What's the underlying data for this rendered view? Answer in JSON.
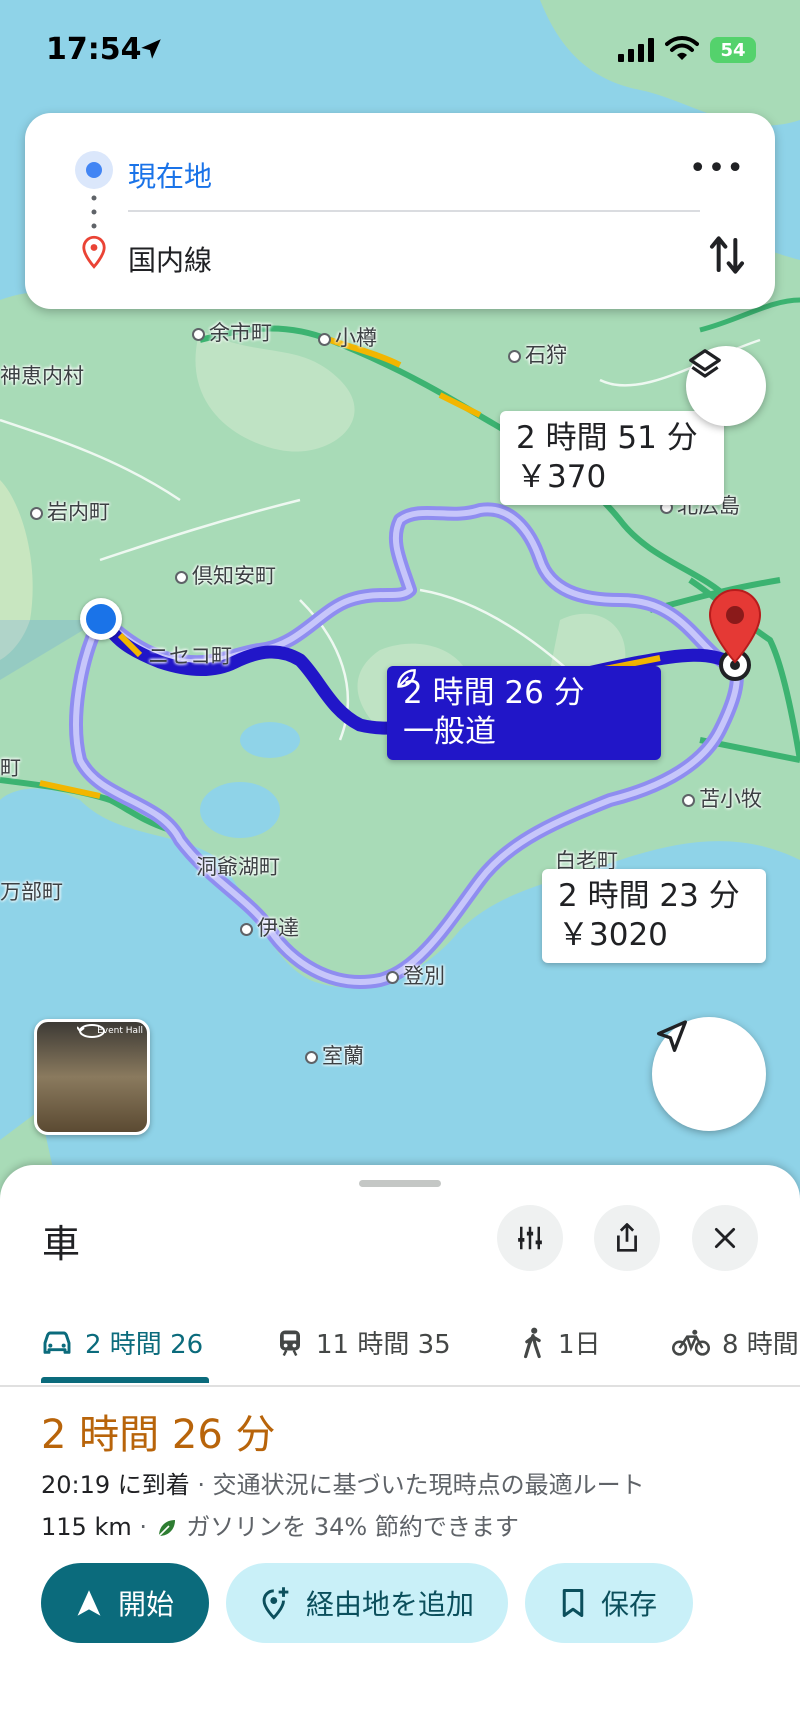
{
  "status_bar": {
    "time": "17:54",
    "battery": "54"
  },
  "search": {
    "origin": "現在地",
    "destination": "国内線",
    "more_label": "•••"
  },
  "map": {
    "place_labels": [
      {
        "name": "余市町"
      },
      {
        "name": "小樽"
      },
      {
        "name": "石狩"
      },
      {
        "name": "神恵内村"
      },
      {
        "name": "岩内町"
      },
      {
        "name": "倶知安町"
      },
      {
        "name": "ニセコ町"
      },
      {
        "name": "北広島"
      },
      {
        "name": "苫小牧"
      },
      {
        "name": "白老町"
      },
      {
        "name": "洞爺湖町"
      },
      {
        "name": "伊達"
      },
      {
        "name": "登別"
      },
      {
        "name": "室蘭"
      },
      {
        "name": "町"
      },
      {
        "name": "万部町"
      }
    ],
    "routes": [
      {
        "time": "2 時間 51 分",
        "detail": "￥370",
        "selected": false
      },
      {
        "time": "2 時間 26 分",
        "detail": "一般道",
        "selected": true,
        "eco": true
      },
      {
        "time": "2 時間 23 分",
        "detail": "￥3020",
        "selected": false
      }
    ],
    "street_view_label": "Event Hall",
    "colors": {
      "selected_route": "#2116c8",
      "alt_route": "#8f8df0",
      "water": "#8fd3e8",
      "land": "#a8dbb7"
    }
  },
  "sheet": {
    "mode_title": "車",
    "tabs": [
      {
        "icon": "car-icon",
        "label": "2 時間 26"
      },
      {
        "icon": "train-icon",
        "label": "11 時間 35"
      },
      {
        "icon": "walk-icon",
        "label": "1日"
      },
      {
        "icon": "bike-icon",
        "label": "8 時間"
      }
    ],
    "duration": "2 時間 26 分",
    "arrival": "20:19 に到着",
    "arrival_note": " · 交通状況に基づいた現時点の最適ルート",
    "distance": "115 km",
    "eco_note": "ガソリンを 34% 節約できます",
    "buttons": {
      "start": "開始",
      "add_stop": "経由地を追加",
      "save": "保存"
    }
  }
}
